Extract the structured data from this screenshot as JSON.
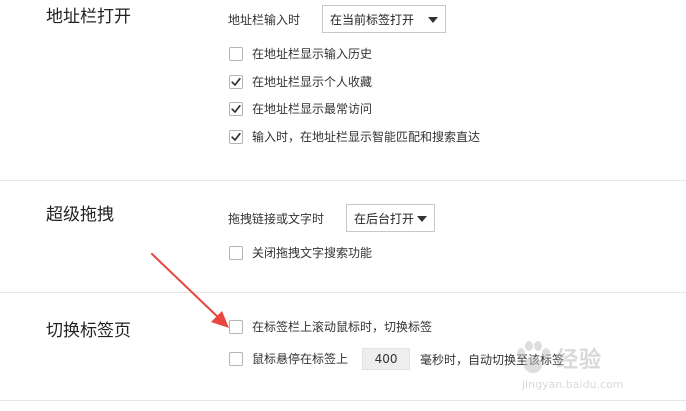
{
  "address_bar": {
    "title": "地址栏打开",
    "input_label": "地址栏输入时",
    "select_value": "在当前标签打开",
    "options": [
      {
        "label": "在地址栏显示输入历史",
        "checked": false
      },
      {
        "label": "在地址栏显示个人收藏",
        "checked": true
      },
      {
        "label": "在地址栏显示最常访问",
        "checked": true
      },
      {
        "label": "输入时，在地址栏显示智能匹配和搜索直达",
        "checked": true
      }
    ]
  },
  "super_drag": {
    "title": "超级拖拽",
    "drag_label": "拖拽链接或文字时",
    "select_value": "在后台打开",
    "options": [
      {
        "label": "关闭拖拽文字搜索功能",
        "checked": false
      }
    ]
  },
  "tab_switch": {
    "title": "切换标签页",
    "options": [
      {
        "label": "在标签栏上滚动鼠标时，切换标签",
        "checked": false
      }
    ],
    "hover_prefix": "鼠标悬停在标签上",
    "hover_value": "400",
    "hover_suffix": "毫秒时，自动切换至该标签",
    "hover_checked": false
  },
  "watermark": {
    "text": "经验",
    "url": "jingyan.baidu.com"
  },
  "colors": {
    "arrow": "#e8473f",
    "check": "#333333",
    "divider": "#e6e6e6"
  }
}
